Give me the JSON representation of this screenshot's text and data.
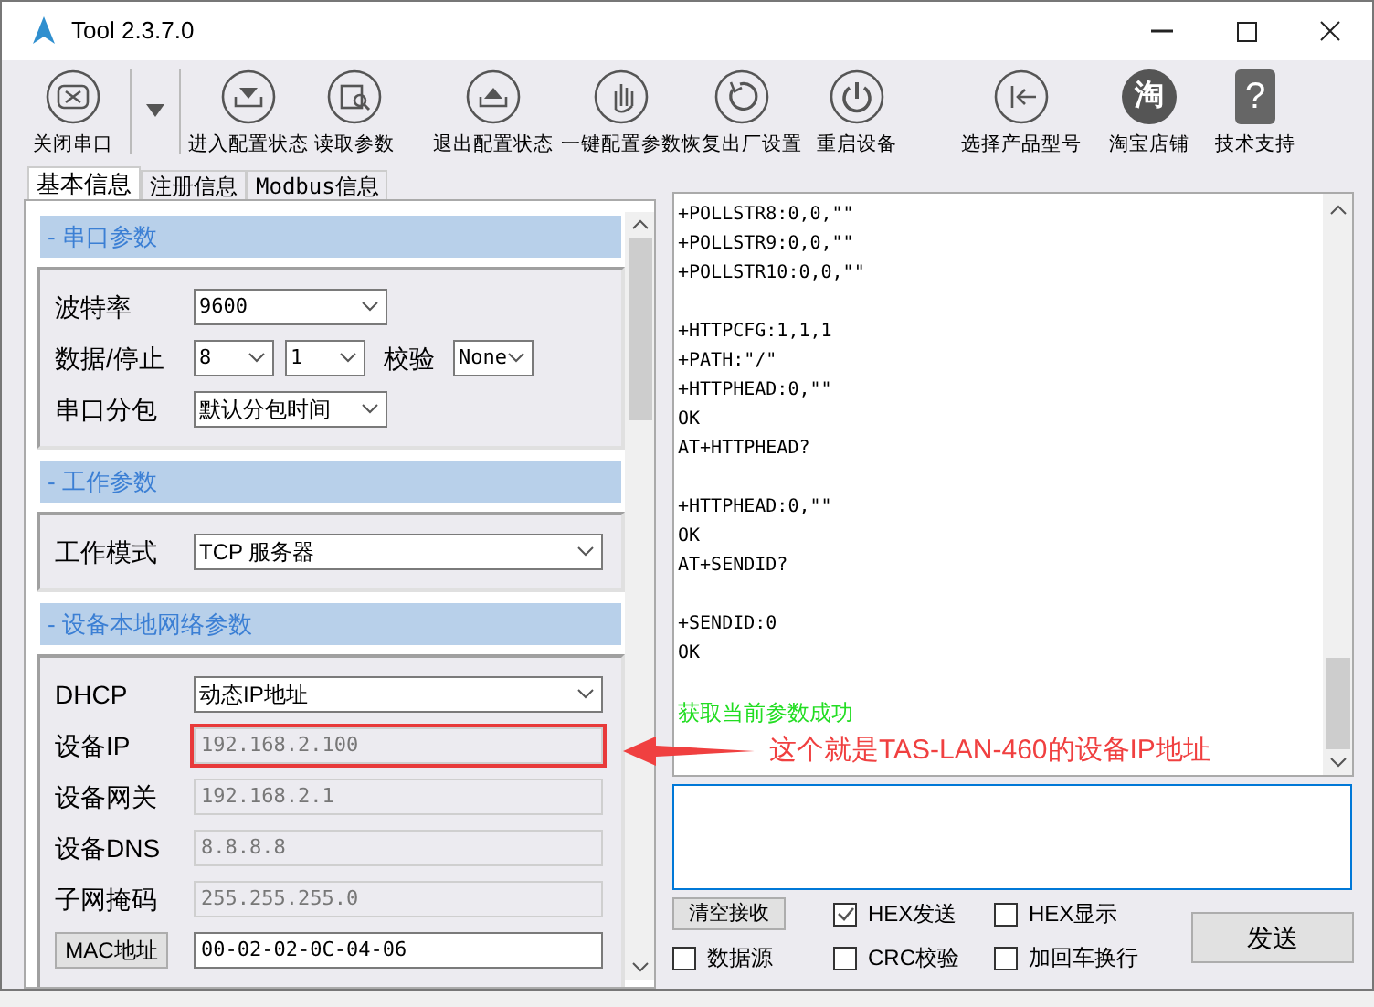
{
  "window": {
    "title": "Tool 2.3.7.0"
  },
  "toolbar": [
    {
      "kind": "close",
      "label": "关闭串口"
    },
    {
      "kind": "menu"
    },
    {
      "kind": "enter",
      "label": "进入配置状态"
    },
    {
      "kind": "read",
      "label": "读取参数"
    },
    {
      "kind": "exit",
      "label": "退出配置状态"
    },
    {
      "kind": "hand",
      "label": "一键配置参数"
    },
    {
      "kind": "restore",
      "label": "恢复出厂设置"
    },
    {
      "kind": "power",
      "label": "重启设备"
    },
    {
      "kind": "back",
      "label": "选择产品型号"
    },
    {
      "kind": "shop",
      "label": "淘宝店铺",
      "icon_text": "淘"
    },
    {
      "kind": "help",
      "label": "技术支持",
      "icon_text": "?"
    }
  ],
  "tabs": [
    {
      "label": "基本信息",
      "selected": true
    },
    {
      "label": "注册信息",
      "selected": false
    },
    {
      "label": "Modbus信息",
      "selected": false
    }
  ],
  "sections": [
    {
      "title": "- 串口参数",
      "rows": [
        {
          "kind": "label",
          "label": "波特率",
          "controls": [
            {
              "kind": "select",
              "value": "9600"
            }
          ]
        },
        {
          "kind": "label",
          "label": "数据/停止",
          "controls": [
            {
              "kind": "select",
              "value": "8"
            },
            {
              "kind": "select",
              "value": "1"
            },
            {
              "kind": "label",
              "text": "校验"
            },
            {
              "kind": "select",
              "value": "None"
            }
          ]
        },
        {
          "kind": "label",
          "label": "串口分包",
          "controls": [
            {
              "kind": "select",
              "value": "默认分包时间"
            }
          ]
        }
      ]
    },
    {
      "title": "- 工作参数",
      "rows": [
        {
          "kind": "label",
          "label": "工作模式",
          "controls": [
            {
              "kind": "select",
              "value": "TCP 服务器"
            }
          ]
        }
      ]
    },
    {
      "title": "- 设备本地网络参数",
      "rows": [
        {
          "kind": "label",
          "label": "DHCP",
          "controls": [
            {
              "kind": "select",
              "value": "动态IP地址"
            }
          ]
        },
        {
          "kind": "label",
          "label": "设备IP",
          "highlighted": true,
          "controls": [
            {
              "kind": "readonly",
              "value": "192.168.2.100"
            }
          ]
        },
        {
          "kind": "label",
          "label": "设备网关",
          "controls": [
            {
              "kind": "readonly",
              "value": "192.168.2.1"
            }
          ]
        },
        {
          "kind": "label",
          "label": "设备DNS",
          "controls": [
            {
              "kind": "readonly",
              "value": "8.8.8.8"
            }
          ]
        },
        {
          "kind": "label",
          "label": "子网掩码",
          "controls": [
            {
              "kind": "readonly",
              "value": "255.255.255.0"
            }
          ]
        },
        {
          "kind": "button",
          "label": "MAC地址",
          "controls": [
            {
              "kind": "text",
              "value": "00-02-02-0C-04-06"
            }
          ]
        }
      ]
    }
  ],
  "log": {
    "blocks": [
      [
        "+POLLSTR8:0,0,\"\"",
        "+POLLSTR9:0,0,\"\"",
        "+POLLSTR10:0,0,\"\""
      ],
      [
        "+HTTPCFG:1,1,1",
        "+PATH:\"/\"",
        "+HTTPHEAD:0,\"\"",
        "OK",
        "AT+HTTPHEAD?"
      ],
      [
        "+HTTPHEAD:0,\"\"",
        "OK",
        "AT+SENDID?"
      ],
      [
        "+SENDID:0",
        "OK"
      ]
    ],
    "status": {
      "kind": "success",
      "text": "获取当前参数成功"
    }
  },
  "annotation": {
    "text": "这个就是TAS-LAN-460的设备IP地址"
  },
  "clear_button": "清空接收",
  "options": [
    {
      "label": "HEX发送",
      "checked": true
    },
    {
      "label": "HEX显示",
      "checked": false
    },
    {
      "label": "数据源",
      "checked": false
    },
    {
      "label": "CRC校验",
      "checked": false
    },
    {
      "label": "加回车换行",
      "checked": false
    }
  ],
  "send_button": "发送"
}
